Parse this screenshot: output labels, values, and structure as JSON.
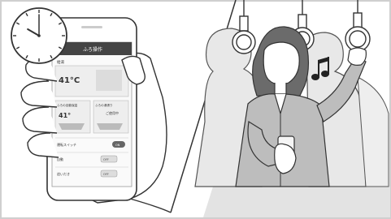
{
  "phone": {
    "header_title": "ふろ操作",
    "back_glyph": "‹",
    "temp_section_title": "給湯",
    "temp_value": "41°C",
    "bath_left_label": "ふろの自動保温",
    "bath_left_value": "41°",
    "bath_right_label": "ふろの湯張り",
    "bath_right_value": "ご使用中",
    "switch_label": "運転スイッチ",
    "row_auto_label": "自動",
    "row_reheat_label": "追いだき",
    "toggle_on": "ON",
    "toggle_off": "OFF",
    "toggle_off2": "OFF"
  },
  "clock": {
    "hour": 10,
    "minute": 0
  },
  "icons": {
    "music": "music-note-icon"
  }
}
